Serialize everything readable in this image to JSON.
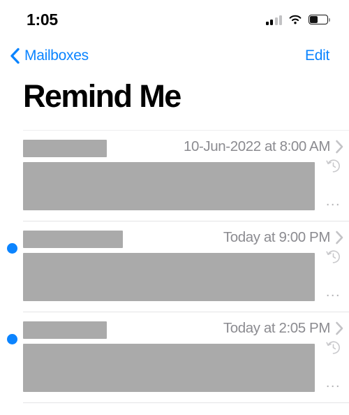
{
  "status_bar": {
    "time": "1:05",
    "cellular_icon": "cellular-signal-icon",
    "cellular_bars_active": 2,
    "cellular_bars_total": 4,
    "wifi_icon": "wifi-icon",
    "battery_icon": "battery-icon",
    "battery_fill_percent": 52
  },
  "nav_bar": {
    "back_icon": "chevron-left-icon",
    "back_label": "Mailboxes",
    "edit_label": "Edit",
    "accent_color": "#0b84ff"
  },
  "page_title": "Remind Me",
  "list": {
    "rows": [
      {
        "unread": false,
        "sender_redacted": true,
        "sender_width": 120,
        "date": "10-Jun-2022 at 8:00 AM",
        "disclosure_icon": "chevron-right-icon",
        "reminder_icon": "clock-arrow-circlepath-icon",
        "preview_redacted": true,
        "overflow_label": "..."
      },
      {
        "unread": true,
        "unread_icon": "unread-dot-icon",
        "sender_redacted": true,
        "sender_width": 143,
        "date": "Today at 9:00 PM",
        "disclosure_icon": "chevron-right-icon",
        "reminder_icon": "clock-arrow-circlepath-icon",
        "preview_redacted": true,
        "overflow_label": "..."
      },
      {
        "unread": true,
        "unread_icon": "unread-dot-icon",
        "sender_redacted": true,
        "sender_width": 120,
        "date": "Today at 2:05 PM",
        "disclosure_icon": "chevron-right-icon",
        "reminder_icon": "clock-arrow-circlepath-icon",
        "preview_redacted": true,
        "overflow_label": "..."
      }
    ]
  },
  "colors": {
    "accent": "#0b84ff",
    "secondary_text": "#8b8b90",
    "separator": "#e4e4e6",
    "redaction": "#aaaaaa"
  }
}
